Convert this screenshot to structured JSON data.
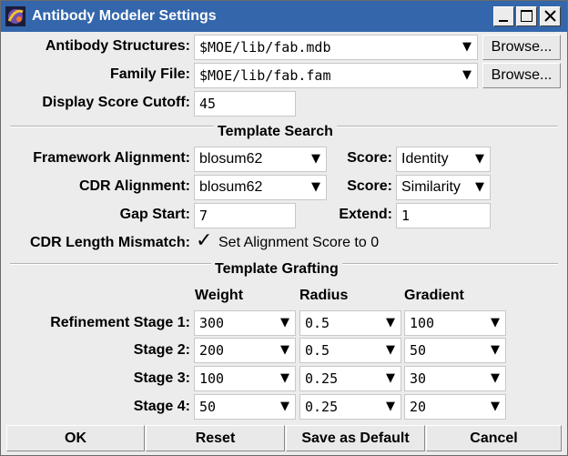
{
  "window": {
    "title": "Antibody Modeler Settings"
  },
  "paths": {
    "structures_label": "Antibody Structures:",
    "structures_value": "$MOE/lib/fab.mdb",
    "family_label": "Family File:",
    "family_value": "$MOE/lib/fab.fam",
    "browse_label": "Browse...",
    "cutoff_label": "Display Score Cutoff:",
    "cutoff_value": "45"
  },
  "template_search": {
    "heading": "Template Search",
    "framework_label": "Framework Alignment:",
    "framework_value": "blosum62",
    "framework_score_label": "Score:",
    "framework_score_value": "Identity",
    "cdr_label": "CDR Alignment:",
    "cdr_value": "blosum62",
    "cdr_score_label": "Score:",
    "cdr_score_value": "Similarity",
    "gap_start_label": "Gap Start:",
    "gap_start_value": "7",
    "extend_label": "Extend:",
    "extend_value": "1",
    "mismatch_label": "CDR Length Mismatch:",
    "mismatch_check": "✓",
    "mismatch_option": "Set Alignment Score to 0"
  },
  "template_grafting": {
    "heading": "Template Grafting",
    "columns": [
      "Weight",
      "Radius",
      "Gradient"
    ],
    "rows": [
      {
        "label": "Refinement Stage 1:",
        "weight": "300",
        "radius": "0.5",
        "gradient": "100"
      },
      {
        "label": "Stage 2:",
        "weight": "200",
        "radius": "0.5",
        "gradient": "50"
      },
      {
        "label": "Stage 3:",
        "weight": "100",
        "radius": "0.25",
        "gradient": "30"
      },
      {
        "label": "Stage 4:",
        "weight": "50",
        "radius": "0.25",
        "gradient": "20"
      }
    ]
  },
  "dropdown_glyph": "▼",
  "footer": {
    "ok": "OK",
    "reset": "Reset",
    "save_default": "Save as Default",
    "cancel": "Cancel"
  }
}
